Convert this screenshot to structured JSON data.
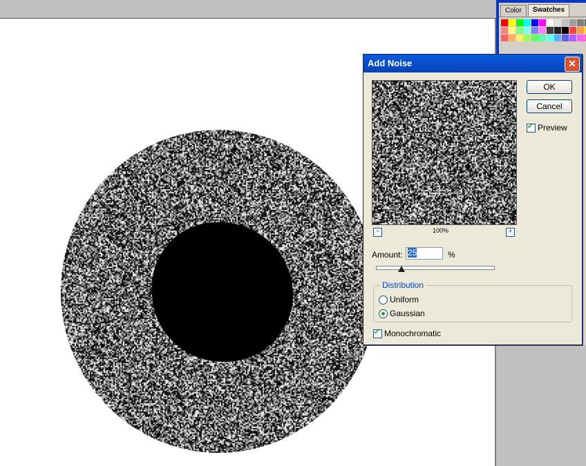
{
  "dialog": {
    "title": "Add Noise",
    "close_icon": "close-icon",
    "ok_label": "OK",
    "cancel_label": "Cancel",
    "preview_label": "Preview",
    "preview_checked": true,
    "zoom_out_symbol": "−",
    "zoom_in_symbol": "+",
    "zoom_level": "100%",
    "amount_label": "Amount:",
    "amount_value": "25",
    "amount_unit": "%",
    "distribution_label": "Distribution",
    "uniform_label": "Uniform",
    "gaussian_label": "Gaussian",
    "selected_distribution": "Gaussian",
    "monochromatic_label": "Monochromatic",
    "monochromatic_checked": true
  },
  "swatches_panel": {
    "tabs": [
      "Color",
      "Swatches"
    ],
    "active_tab": "Swatches",
    "colors": [
      "#ff0000",
      "#ffff00",
      "#00ff00",
      "#00ffff",
      "#0000ff",
      "#ff00ff",
      "#ffffff",
      "#e0e0e0",
      "#c0c0c0",
      "#a0a0a0",
      "#808080",
      "#606060",
      "#ff8080",
      "#ffff80",
      "#80ff80",
      "#80ffff",
      "#8080ff",
      "#ff80ff",
      "#404040",
      "#202020",
      "#000000",
      "#ff4040",
      "#ffa040",
      "#ffe040",
      "#ff6060",
      "#ffb060",
      "#fff060",
      "#a0ff60",
      "#60ff60",
      "#60ffb0",
      "#60ffff",
      "#60b0ff",
      "#6060ff",
      "#b060ff",
      "#ff60ff",
      "#ff60b0"
    ]
  }
}
